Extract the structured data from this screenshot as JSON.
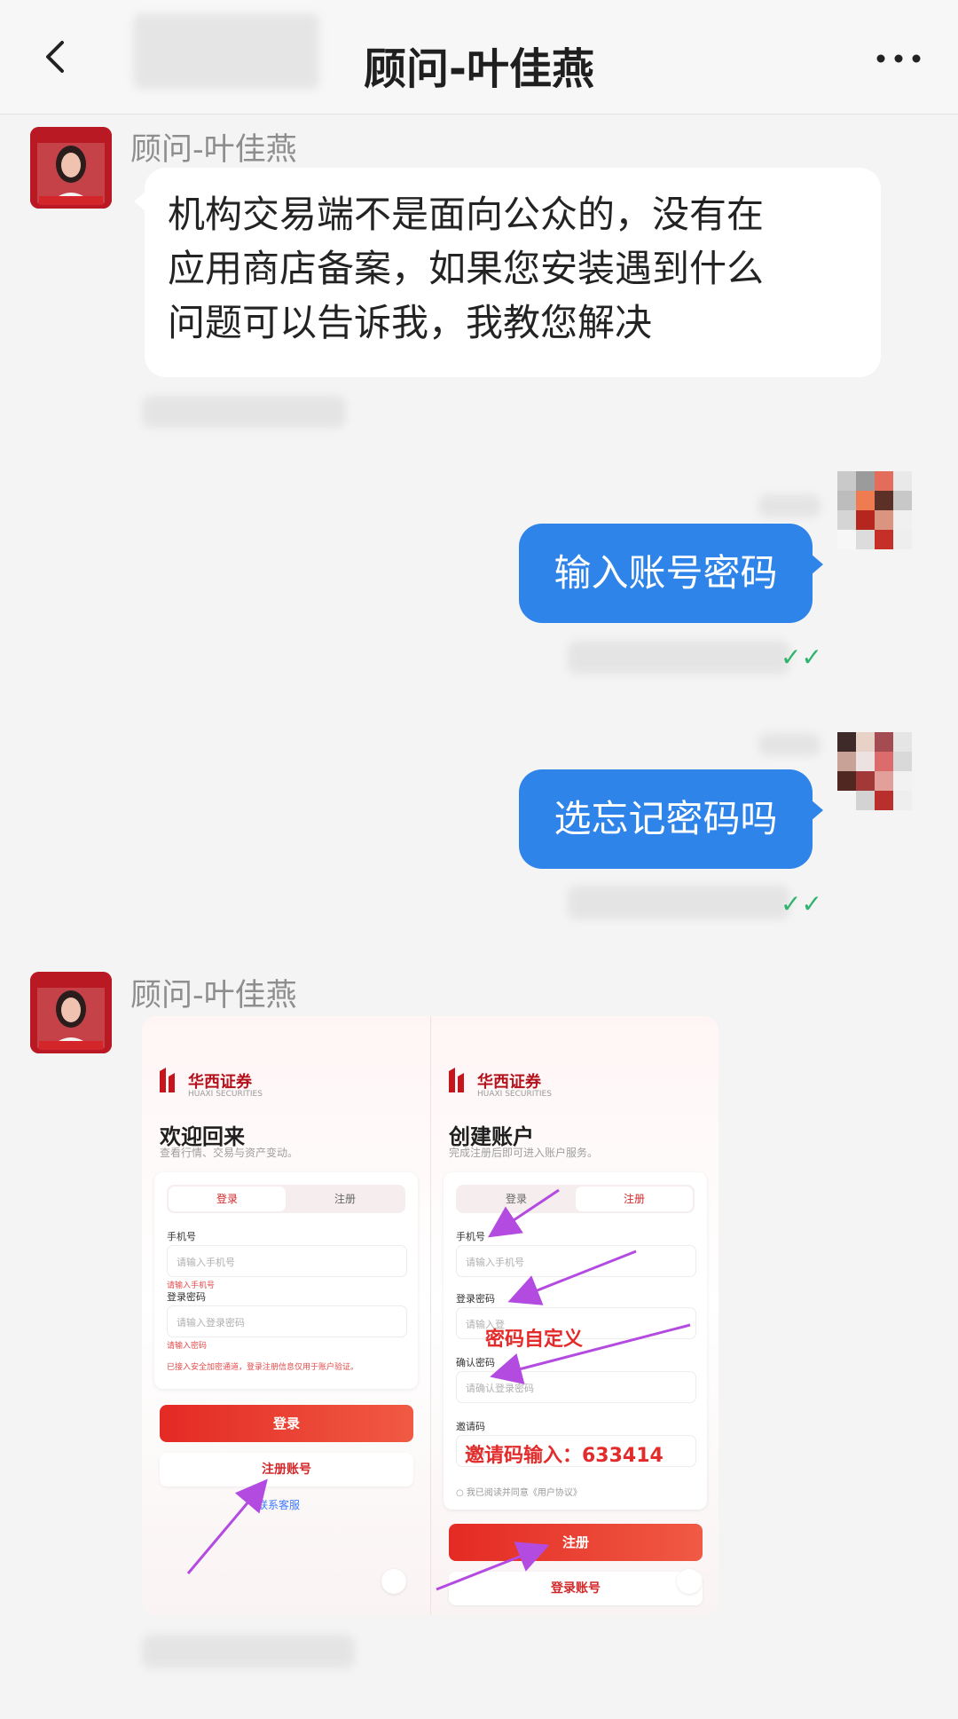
{
  "header": {
    "title": "顾问-叶佳燕"
  },
  "messages": [
    {
      "sender": "顾问-叶佳燕",
      "text_lines": [
        "机构交易端不是面向公众的，没有在",
        "应用商店备案，如果您安装遇到什么",
        "问题可以告诉我，我教您解决"
      ]
    },
    {
      "sender_self": true,
      "text": "输入账号密码"
    },
    {
      "sender_self": true,
      "text": "选忘记密码吗"
    },
    {
      "sender": "顾问-叶佳燕"
    }
  ],
  "screenshot": {
    "brand": "华西证券",
    "brand_en": "HUAXI SECURITIES",
    "left": {
      "title": "欢迎回来",
      "subtitle": "查看行情、交易与资产变动。",
      "tab_login": "登录",
      "tab_register": "注册",
      "phone_label": "手机号",
      "phone_placeholder": "请输入手机号",
      "phone_error": "请输入手机号",
      "password_label": "登录密码",
      "password_placeholder": "请输入登录密码",
      "password_error": "请输入密码",
      "notice": "已接入安全加密通道，登录注册信息仅用于账户验证。",
      "login_button": "登录",
      "register_button": "注册账号",
      "service_link": "联系客服"
    },
    "right": {
      "title": "创建账户",
      "subtitle": "完成注册后即可进入账户服务。",
      "tab_login": "登录",
      "tab_register": "注册",
      "phone_label": "手机号",
      "phone_placeholder": "请输入手机号",
      "password_label": "登录密码",
      "password_placeholder": "请输入登",
      "confirm_label": "确认密码",
      "confirm_placeholder": "请确认登录密码",
      "invite_label": "邀请码",
      "invite_placeholder": "请输",
      "agreement": "我已阅读并同意《用户协议》",
      "register_button": "注册",
      "login_button": "登录账号"
    },
    "annotations": {
      "password_custom": "密码自定义",
      "invite_code": "邀请码输入：633414"
    }
  }
}
